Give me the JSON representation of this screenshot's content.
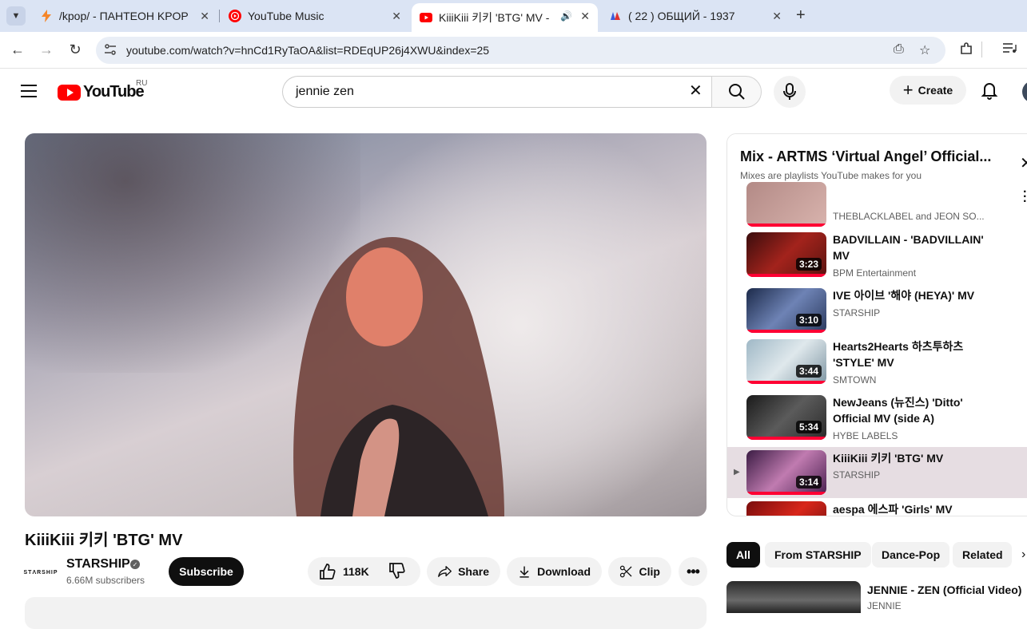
{
  "browser": {
    "tabs": [
      {
        "title": "/kpop/ - ПАНТЕОН KPOP",
        "active": false
      },
      {
        "title": "YouTube Music",
        "active": false
      },
      {
        "title": "KiiiKiii 키키 'BTG' MV -",
        "active": true
      },
      {
        "title": "( 22 ) ОБЩИЙ - 1937",
        "active": false
      }
    ],
    "url": "youtube.com/watch?v=hnCd1RyTaOA&list=RDEqUP26j4XWU&index=25"
  },
  "masthead": {
    "logo_text": "YouTube",
    "country_code": "RU",
    "search_value": "jennie zen",
    "create_label": "Create"
  },
  "video": {
    "title": "KiiiKiii 키키 'BTG' MV",
    "channel": "STARSHIP",
    "channel_logo_text": "STΛRSHIP",
    "subscribers": "6.66M subscribers",
    "subscribe_label": "Subscribe",
    "likes": "118K",
    "share_label": "Share",
    "download_label": "Download",
    "clip_label": "Clip"
  },
  "playlist": {
    "title": "Mix - ARTMS ‘Virtual Angel’ Official...",
    "subtitle": "Mixes are playlists YouTube makes for you",
    "items": [
      {
        "title": "",
        "channel": "THEBLACKLABEL and JEON SO...",
        "duration": "",
        "current": false
      },
      {
        "title": "BADVILLAIN - 'BADVILLAIN' MV",
        "channel": "BPM Entertainment",
        "duration": "3:23",
        "current": false
      },
      {
        "title": "IVE 아이브 '해야 (HEYA)' MV",
        "channel": "STARSHIP",
        "duration": "3:10",
        "current": false
      },
      {
        "title": "Hearts2Hearts 하츠투하츠 'STYLE' MV",
        "channel": "SMTOWN",
        "duration": "3:44",
        "current": false
      },
      {
        "title": "NewJeans (뉴진스) 'Ditto' Official MV (side A)",
        "channel": "HYBE LABELS",
        "duration": "5:34",
        "current": false
      },
      {
        "title": "KiiiKiii 키키 'BTG' MV",
        "channel": "STARSHIP",
        "duration": "3:14",
        "current": true
      },
      {
        "title": "aespa 에스파 'Girls' MV",
        "channel": "",
        "duration": "",
        "current": false
      }
    ]
  },
  "chips": [
    "All",
    "From STARSHIP",
    "Dance-Pop",
    "Related"
  ],
  "related": {
    "title": "JENNIE - ZEN (Official Video)",
    "channel": "JENNIE"
  },
  "colors": {
    "brand_red": "#ff0000",
    "progress_red": "#ff0033",
    "current_row": "#e6dde2"
  }
}
